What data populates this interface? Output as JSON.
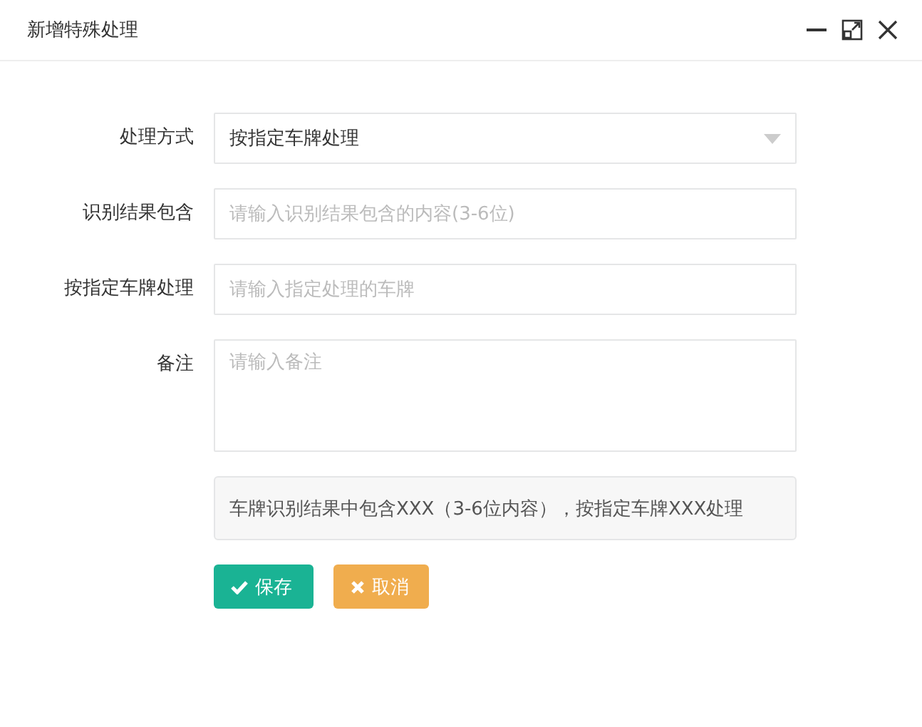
{
  "window": {
    "title": "新增特殊处理"
  },
  "fields": [
    {
      "kind": "select",
      "label": "处理方式",
      "value": "按指定车牌处理"
    },
    {
      "kind": "text",
      "label": "识别结果包含",
      "placeholder": "请输入识别结果包含的内容(3-6位)"
    },
    {
      "kind": "text",
      "label": "按指定车牌处理",
      "placeholder": "请输入指定处理的车牌"
    },
    {
      "kind": "textarea",
      "label": "备注",
      "placeholder": "请输入备注"
    }
  ],
  "hint": "车牌识别结果中包含XXX（3-6位内容），按指定车牌XXX处理",
  "buttons": [
    {
      "kind": "save",
      "label": "保存"
    },
    {
      "kind": "cancel",
      "label": "取消"
    }
  ]
}
